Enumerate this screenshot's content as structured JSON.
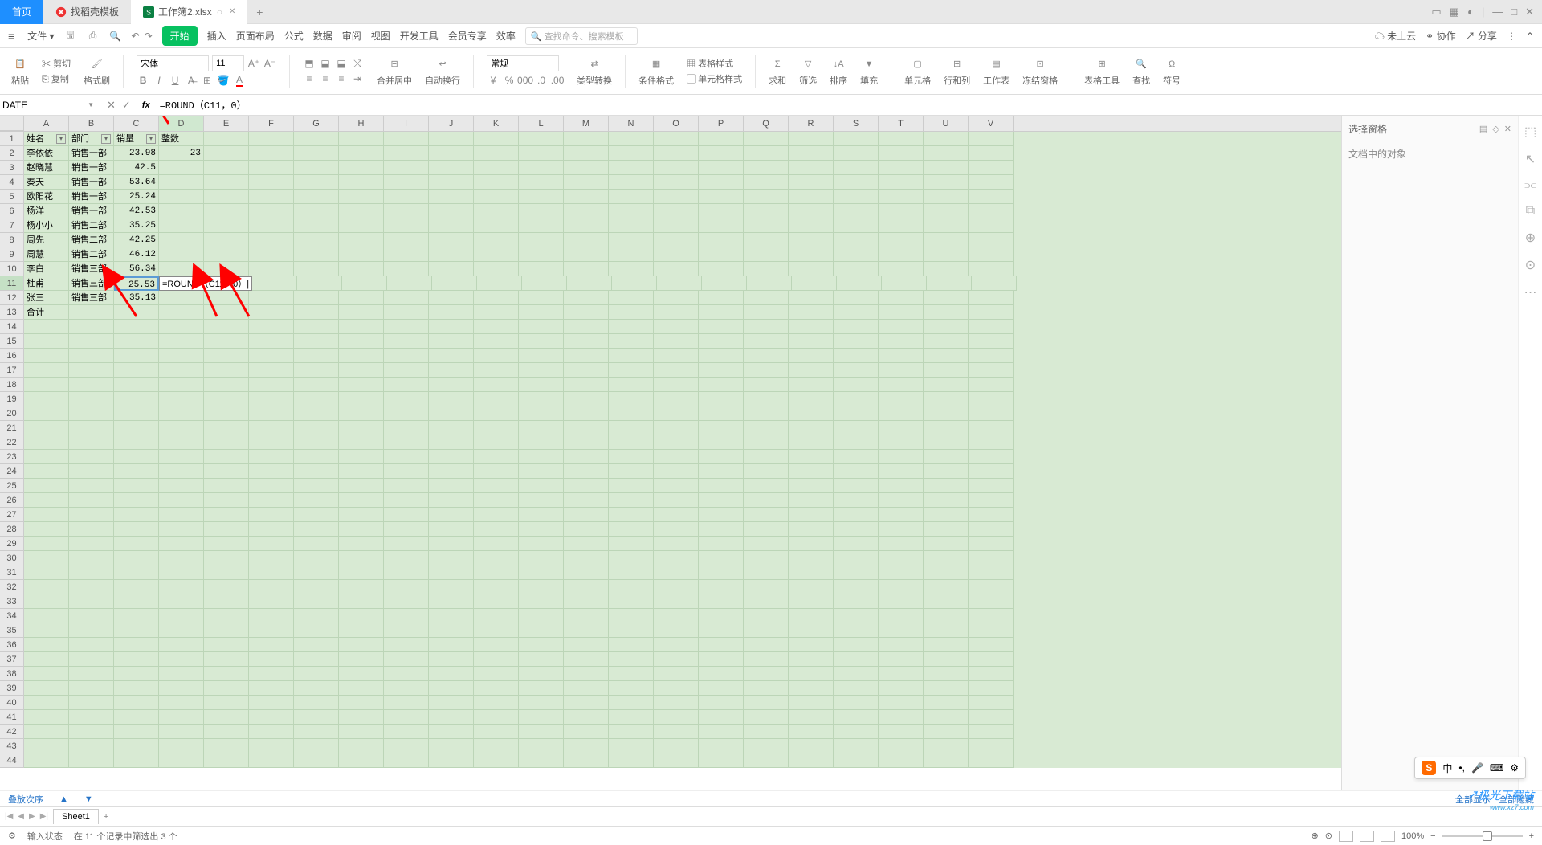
{
  "title_tabs": {
    "home": "首页",
    "template": "找稻壳模板",
    "workbook": "工作簿2.xlsx"
  },
  "menu": {
    "file": "文件",
    "items": [
      "开始",
      "插入",
      "页面布局",
      "公式",
      "数据",
      "审阅",
      "视图",
      "开发工具",
      "会员专享",
      "效率"
    ],
    "search_placeholder": "查找命令、搜索模板",
    "cloud": "未上云",
    "coop": "协作",
    "share": "分享"
  },
  "ribbon": {
    "paste": "粘贴",
    "cut": "剪切",
    "copy": "复制",
    "format_painter": "格式刷",
    "font": "宋体",
    "size": "11",
    "merge": "合并居中",
    "wrap": "自动换行",
    "number_format": "常规",
    "type_convert": "类型转换",
    "cond_format": "条件格式",
    "table_style": "表格样式",
    "cell_style": "单元格样式",
    "sum": "求和",
    "filter": "筛选",
    "sort": "排序",
    "fill": "填充",
    "cell": "单元格",
    "rowcol": "行和列",
    "sheet": "工作表",
    "freeze": "冻结窗格",
    "table_tools": "表格工具",
    "find": "查找",
    "symbol": "符号"
  },
  "formula": {
    "namebox": "DATE",
    "value": "=ROUND（C11，0）"
  },
  "columns": [
    "A",
    "B",
    "C",
    "D",
    "E",
    "F",
    "G",
    "H",
    "I",
    "J",
    "K",
    "L",
    "M",
    "N",
    "O",
    "P",
    "Q",
    "R",
    "S",
    "T",
    "U",
    "V"
  ],
  "headers": {
    "a": "姓名",
    "b": "部门",
    "c": "销量",
    "d": "整数"
  },
  "rows": [
    {
      "a": "李依依",
      "b": "销售一部",
      "c": "23.98",
      "d": "23"
    },
    {
      "a": "赵晓慧",
      "b": "销售一部",
      "c": "42.5",
      "d": ""
    },
    {
      "a": "秦天",
      "b": "销售一部",
      "c": "53.64",
      "d": ""
    },
    {
      "a": "欧阳花",
      "b": "销售一部",
      "c": "25.24",
      "d": ""
    },
    {
      "a": "杨洋",
      "b": "销售一部",
      "c": "42.53",
      "d": ""
    },
    {
      "a": "杨小小",
      "b": "销售二部",
      "c": "35.25",
      "d": ""
    },
    {
      "a": "周先",
      "b": "销售二部",
      "c": "42.25",
      "d": ""
    },
    {
      "a": "周慧",
      "b": "销售二部",
      "c": "46.12",
      "d": ""
    },
    {
      "a": "李白",
      "b": "销售三部",
      "c": "56.34",
      "d": ""
    },
    {
      "a": "杜甫",
      "b": "销售三部",
      "c": "25.53",
      "d": "=ROUND（C11，0）"
    },
    {
      "a": "张三",
      "b": "销售三部",
      "c": "35.13",
      "d": ""
    },
    {
      "a": "合计",
      "b": "",
      "c": "",
      "d": ""
    }
  ],
  "side": {
    "title": "选择窗格",
    "sub": "文档中的对象"
  },
  "link": {
    "order": "叠放次序",
    "show_all": "全部显示",
    "hide_all": "全部隐藏"
  },
  "sheet_tab": "Sheet1",
  "status": {
    "mode": "输入状态",
    "info": "在 11 个记录中筛选出 3 个",
    "zoom": "100%"
  },
  "ime": {
    "mode": "中"
  },
  "watermark": {
    "main": "极光下载站",
    "sub": "www.xz7.com"
  }
}
